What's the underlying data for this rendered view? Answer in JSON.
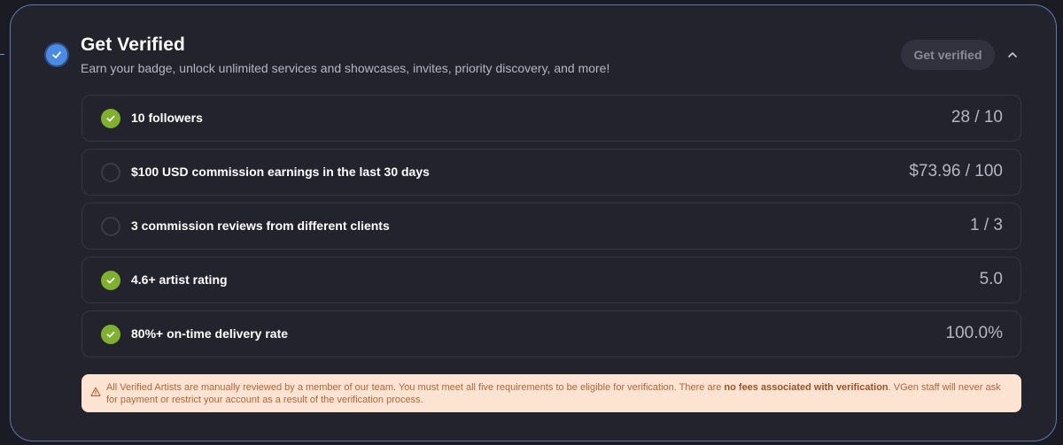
{
  "header": {
    "title": "Get Verified",
    "subtitle": "Earn your badge, unlock unlimited services and showcases, invites, priority discovery, and more!",
    "button_label": "Get verified",
    "badge_icon": "check-circle-icon",
    "collapse_icon": "chevron-up-icon"
  },
  "requirements": [
    {
      "label": "10 followers",
      "value": "28 / 10",
      "status": "done"
    },
    {
      "label": "$100 USD commission earnings in the last 30 days",
      "value": "$73.96 / 100",
      "status": "pending"
    },
    {
      "label": "3 commission reviews from different clients",
      "value": "1 / 3",
      "status": "pending"
    },
    {
      "label": "4.6+ artist rating",
      "value": "5.0",
      "status": "done"
    },
    {
      "label": "80%+ on-time delivery rate",
      "value": "100.0%",
      "status": "done"
    }
  ],
  "notice": {
    "icon": "warning-icon",
    "text_before": "All Verified Artists are manually reviewed by a member of our team. You must meet all five requirements to be eligible for verification. There are ",
    "text_bold": "no fees associated with verification",
    "text_after": ". VGen staff will never ask for payment or restrict your account as a result of the verification process."
  },
  "colors": {
    "background": "#1b1b24",
    "card": "#23232e",
    "card_border": "#5f78b8",
    "accent_blue": "#4a8ce3",
    "done_green": "#7fb12e",
    "notice_bg": "#fde4d2",
    "notice_text": "#b0643a"
  }
}
